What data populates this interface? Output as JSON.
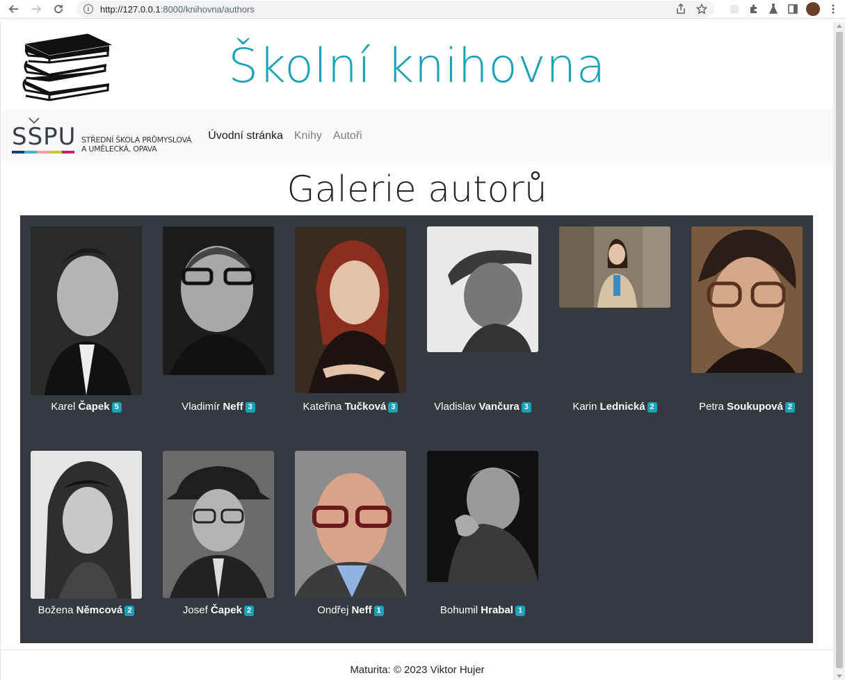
{
  "browser": {
    "url_host": "http://127.0.0.1",
    "url_rest": ":8000/knihovna/authors"
  },
  "site": {
    "title": "Školní knihovna",
    "school_logo_text": "SŠPU",
    "school_line1": "STŘEDNÍ ŠKOLA PRŮMYSLOVÁ",
    "school_line2": "A UMĚLECKÁ, OPAVA"
  },
  "nav": {
    "items": [
      {
        "label": "Úvodní stránka",
        "active": true
      },
      {
        "label": "Knihy",
        "active": false
      },
      {
        "label": "Autoři",
        "active": false
      }
    ]
  },
  "gallery": {
    "title": "Galerie autorů",
    "authors": [
      {
        "first": "Karel",
        "last": "Čapek",
        "count": "5"
      },
      {
        "first": "Vladimír",
        "last": "Neff",
        "count": "3"
      },
      {
        "first": "Kateřina",
        "last": "Tučková",
        "count": "3"
      },
      {
        "first": "Vladislav",
        "last": "Vančura",
        "count": "3"
      },
      {
        "first": "Karin",
        "last": "Lednická",
        "count": "2"
      },
      {
        "first": "Petra",
        "last": "Soukupová",
        "count": "2"
      },
      {
        "first": "Božena",
        "last": "Němcová",
        "count": "2"
      },
      {
        "first": "Josef",
        "last": "Čapek",
        "count": "2"
      },
      {
        "first": "Ondřej",
        "last": "Neff",
        "count": "1"
      },
      {
        "first": "Bohumil",
        "last": "Hrabal",
        "count": "1"
      }
    ]
  },
  "footer": {
    "text": "Maturita: © 2023 Viktor Hujer"
  },
  "colors": {
    "accent": "#17a2b8",
    "gallery_bg": "#343a40",
    "navbar_bg": "#f8f9fa"
  }
}
